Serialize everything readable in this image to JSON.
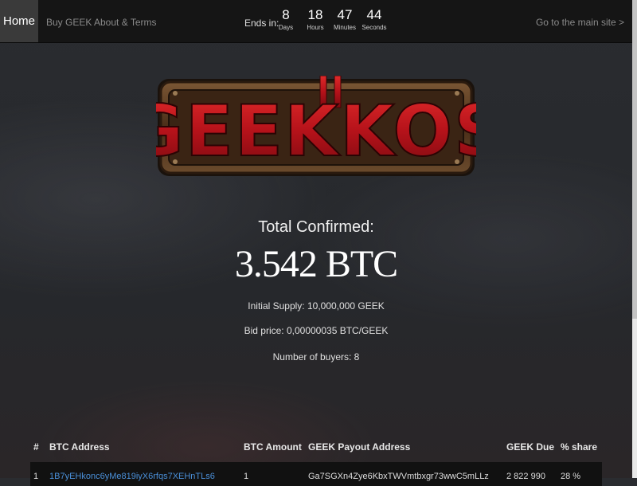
{
  "nav": {
    "home": "Home",
    "buy": "Buy GEEK",
    "about": "About & Terms",
    "main_site": "Go to the main site >"
  },
  "countdown": {
    "label": "Ends in:",
    "units": [
      {
        "value": "8",
        "label": "Days"
      },
      {
        "value": "18",
        "label": "Hours"
      },
      {
        "value": "47",
        "label": "Minutes"
      },
      {
        "value": "44",
        "label": "Seconds"
      }
    ]
  },
  "logo": {
    "text": "GEEKKOS"
  },
  "stats": {
    "total_label": "Total Confirmed:",
    "total_value": "3.542 BTC",
    "initial_supply": "Initial Supply: 10,000,000 GEEK",
    "bid_price": "Bid price: 0,00000035 BTC/GEEK",
    "buyers": "Number of buyers: 8"
  },
  "table": {
    "headers": [
      "#",
      "BTC Address",
      "BTC Amount",
      "GEEK Payout Address",
      "GEEK Due",
      "% share"
    ],
    "rows": [
      [
        "1",
        "1B7yEHkonc6yMe819iyX6rfqs7XEHnTLs6",
        "1",
        "Ga7SGXn4Zye6KbxTWVmtbxgr73wwC5mLLz",
        "2 822 990",
        "28 %"
      ]
    ]
  },
  "colors": {
    "navbar": "#151515",
    "home_active": "#3a3a3a",
    "link": "#4a8fd8",
    "logo_red": "#c4161c",
    "logo_frame": "#5a3a22"
  }
}
